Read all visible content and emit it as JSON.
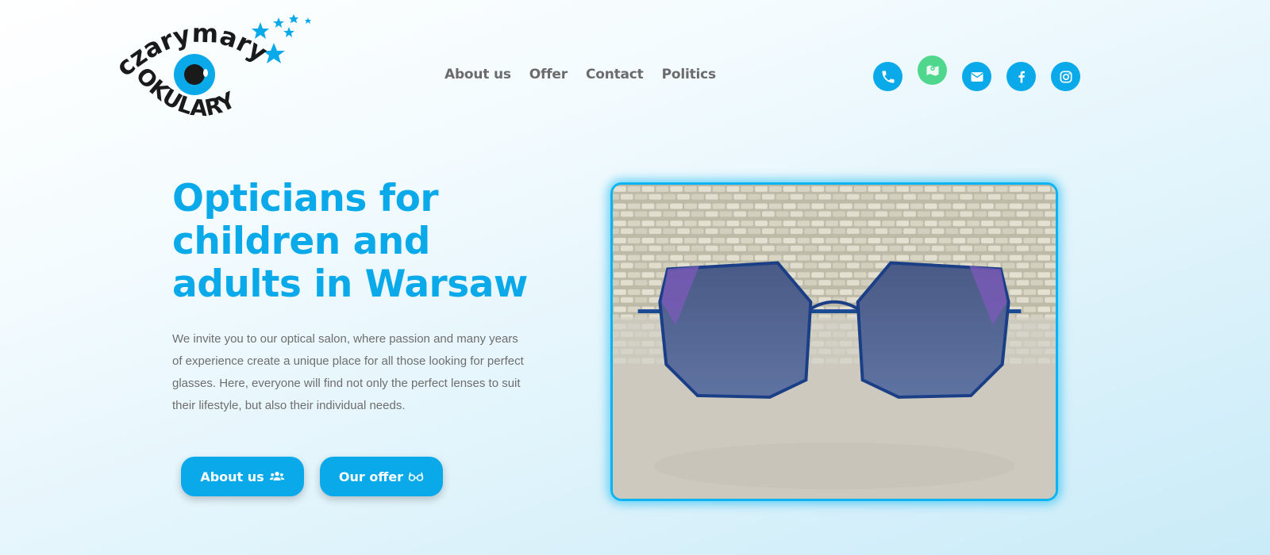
{
  "logo": {
    "top_text": "czarymary",
    "bottom_text": "OKULARY"
  },
  "nav": {
    "items": [
      {
        "label": "About us"
      },
      {
        "label": "Offer"
      },
      {
        "label": "Contact"
      },
      {
        "label": "Politics"
      }
    ]
  },
  "social": {
    "icons": [
      "phone-icon",
      "map-icon",
      "envelope-icon",
      "facebook-icon",
      "instagram-icon"
    ],
    "colors": {
      "default": "#0aa9ea",
      "map": "#4fd78d"
    }
  },
  "hero": {
    "title_line1": "Opticians for",
    "title_line2": "children and",
    "title_line3": "adults in Warsaw",
    "text": "We invite you to our optical salon, where passion and many years of experience create a unique place for all those looking for perfect glasses. Here, everyone will find not only the perfect lenses to suit their lifestyle, but also their individual needs.",
    "buttons": {
      "about_label": "About us",
      "offer_label": "Our offer"
    }
  },
  "colors": {
    "accent": "#0aa9ea",
    "text_gray": "#6e6e6e",
    "nav_gray": "#6b6b6b"
  }
}
